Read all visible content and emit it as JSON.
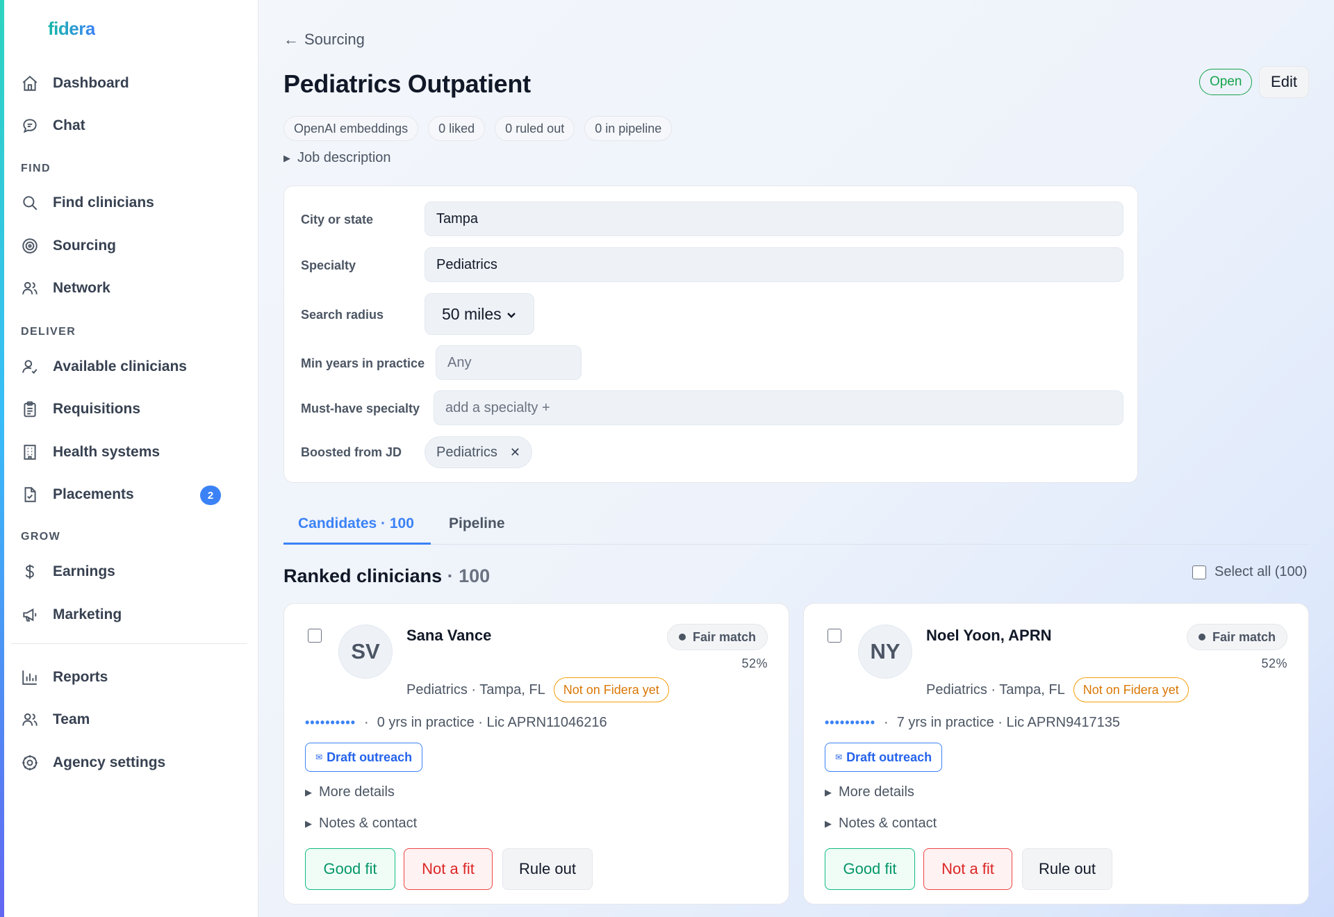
{
  "app": {
    "logo": "fidera"
  },
  "sidebar": {
    "items_top": [
      {
        "label": "Dashboard",
        "icon": "home-icon"
      },
      {
        "label": "Chat",
        "icon": "chat-icon"
      }
    ],
    "sections": {
      "find": "FIND",
      "deliver": "DELIVER",
      "grow": "GROW"
    },
    "find_items": [
      {
        "label": "Find clinicians",
        "icon": "search-icon"
      },
      {
        "label": "Sourcing",
        "icon": "target-icon"
      },
      {
        "label": "Network",
        "icon": "users-icon"
      }
    ],
    "deliver_items": [
      {
        "label": "Available clinicians",
        "icon": "user-check-icon"
      },
      {
        "label": "Requisitions",
        "icon": "clipboard-icon"
      },
      {
        "label": "Health systems",
        "icon": "building-icon"
      },
      {
        "label": "Placements",
        "icon": "file-check-icon",
        "badge": "2"
      }
    ],
    "grow_items": [
      {
        "label": "Earnings",
        "icon": "dollar-icon"
      },
      {
        "label": "Marketing",
        "icon": "megaphone-icon"
      }
    ],
    "bottom_items": [
      {
        "label": "Reports",
        "icon": "bar-chart-icon"
      },
      {
        "label": "Team",
        "icon": "team-icon"
      },
      {
        "label": "Agency settings",
        "icon": "gear-icon"
      }
    ]
  },
  "header": {
    "back_label": "Sourcing",
    "title": "Pediatrics Outpatient",
    "status": "Open",
    "edit_label": "Edit",
    "chips": [
      "OpenAI embeddings",
      "0 liked",
      "0 ruled out",
      "0 in pipeline"
    ],
    "jd_toggle": "Job description"
  },
  "filters": {
    "city_label": "City or state",
    "city_value": "Tampa",
    "specialty_label": "Specialty",
    "specialty_value": "Pediatrics",
    "radius_label": "Search radius",
    "radius_value": "50 miles",
    "min_years_label": "Min years in practice",
    "min_years_placeholder": "Any",
    "must_have_label": "Must-have specialty",
    "must_have_placeholder": "add a specialty +",
    "boosted_label": "Boosted from JD",
    "boosted_tag": "Pediatrics"
  },
  "tabs": {
    "candidates": "Candidates · 100",
    "pipeline": "Pipeline"
  },
  "ranked": {
    "title": "Ranked clinicians",
    "count": "· 100",
    "select_all": "Select all (100)"
  },
  "candidates": [
    {
      "initials": "SV",
      "name": "Sana Vance",
      "match": "Fair match",
      "match_pct": "52%",
      "meta": "Pediatrics · Tampa, FL",
      "network_badge": "Not on Fidera yet",
      "dots": "••••••••••",
      "details": "0 yrs in practice · Lic APRN11046216",
      "draft": "Draft outreach",
      "more": "More details",
      "notes": "Notes & contact",
      "good": "Good fit",
      "bad": "Not a fit",
      "rule": "Rule out"
    },
    {
      "initials": "NY",
      "name": "Noel Yoon, APRN",
      "match": "Fair match",
      "match_pct": "52%",
      "meta": "Pediatrics · Tampa, FL",
      "network_badge": "Not on Fidera yet",
      "dots": "••••••••••",
      "details": "7 yrs in practice · Lic APRN9417135",
      "draft": "Draft outreach",
      "more": "More details",
      "notes": "Notes & contact",
      "good": "Good fit",
      "bad": "Not a fit",
      "rule": "Rule out"
    }
  ]
}
